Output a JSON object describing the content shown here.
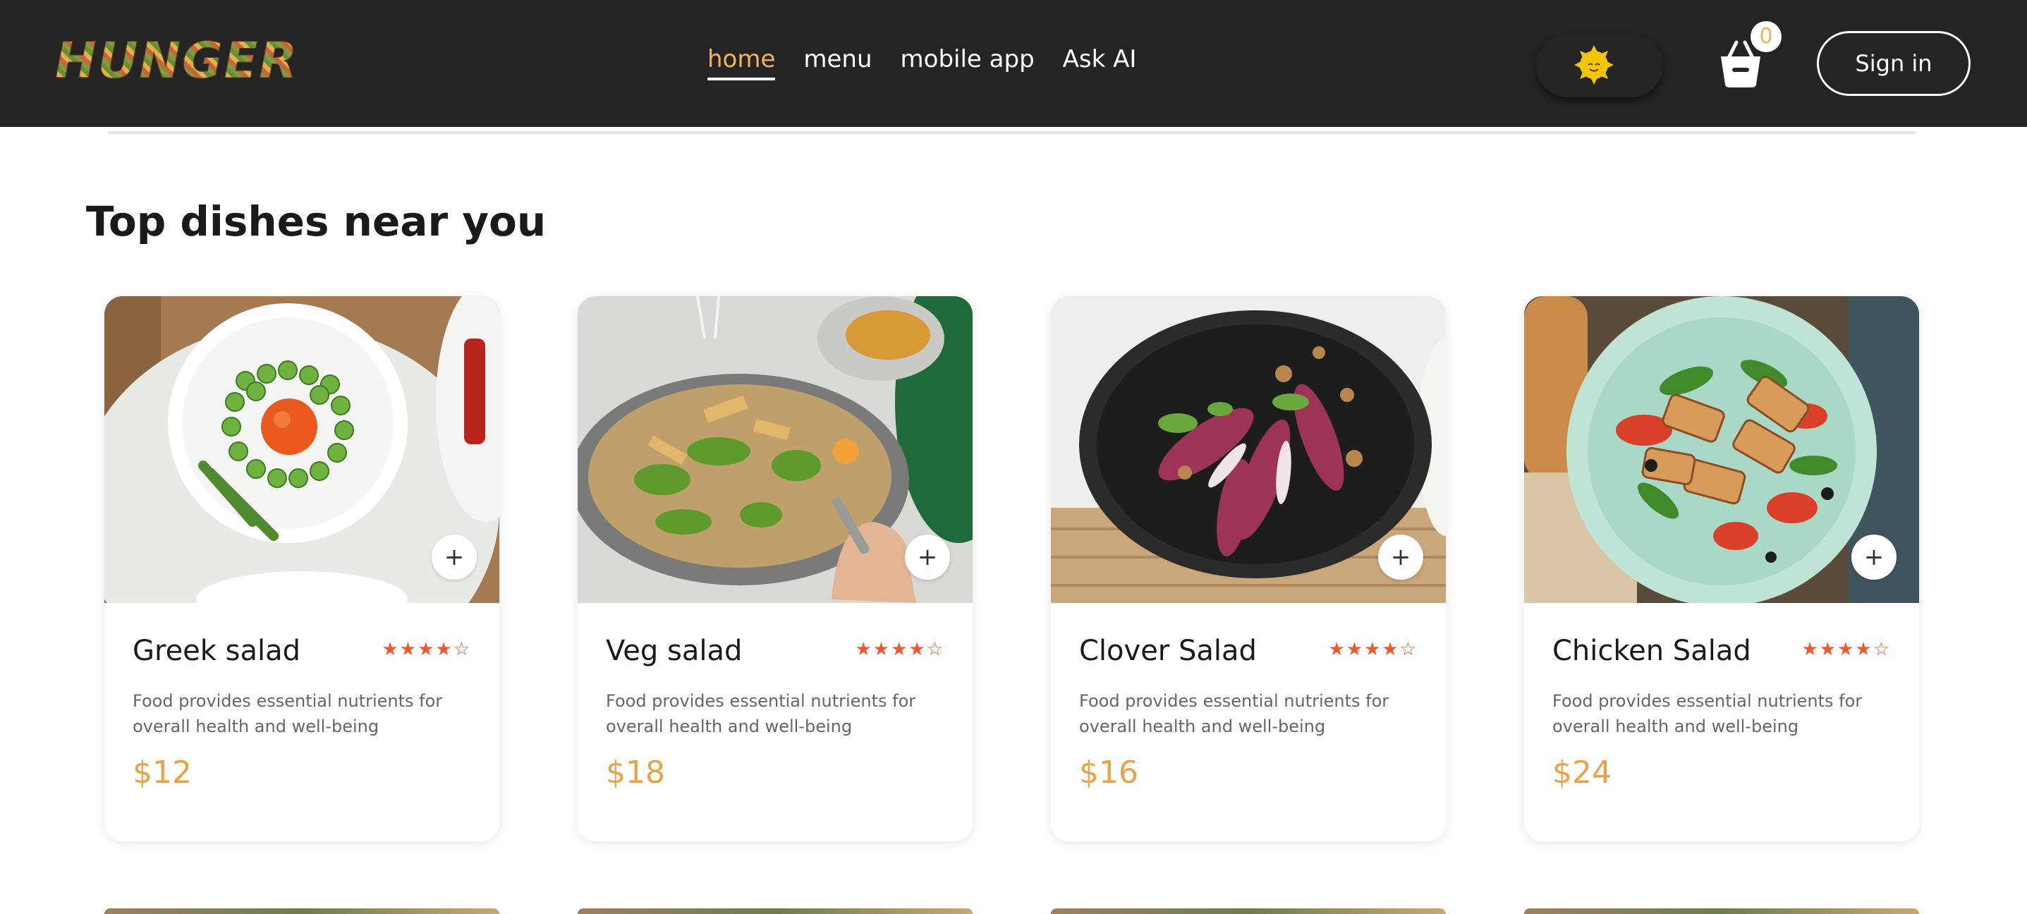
{
  "header": {
    "logo_text": "HUNGER",
    "nav": [
      "home",
      "menu",
      "mobile app",
      "Ask AI"
    ],
    "active_nav": "home",
    "cart_count": "0",
    "signin_label": "Sign in"
  },
  "section": {
    "title": "Top dishes near you"
  },
  "dishes": [
    {
      "name": "Greek salad",
      "rating": 4,
      "description": "Food provides essential nutrients for overall health and well-being",
      "price": "$12",
      "add_label": "+"
    },
    {
      "name": "Veg salad",
      "rating": 4,
      "description": "Food provides essential nutrients for overall health and well-being",
      "price": "$18",
      "add_label": "+"
    },
    {
      "name": "Clover Salad",
      "rating": 4,
      "description": "Food provides essential nutrients for overall health and well-being",
      "price": "$16",
      "add_label": "+"
    },
    {
      "name": "Chicken Salad",
      "rating": 4,
      "description": "Food provides essential nutrients for overall health and well-being",
      "price": "$24",
      "add_label": "+"
    }
  ],
  "colors": {
    "header_bg": "#242424",
    "accent": "#f2b35a",
    "price": "#e8a24a",
    "star": "#ec5a2e"
  },
  "icons": [
    "sun-icon",
    "basket-icon",
    "plus-icon",
    "star-icon"
  ]
}
